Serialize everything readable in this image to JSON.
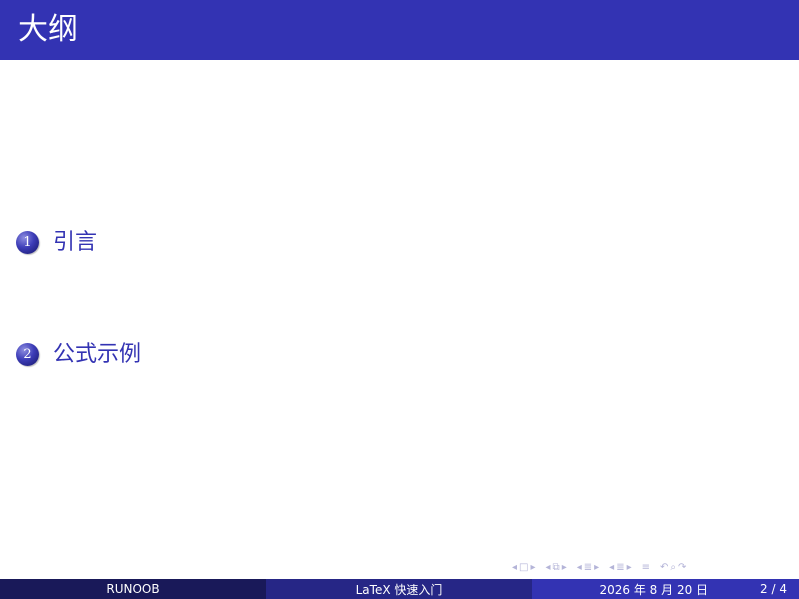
{
  "frame": {
    "title": "大纲"
  },
  "toc": {
    "items": [
      {
        "number": "1",
        "label": "引言"
      },
      {
        "number": "2",
        "label": "公式示例"
      }
    ]
  },
  "nav": {
    "icons": [
      "prev-arrow",
      "frame-icon",
      "next-arrow",
      "subsection-icon",
      "section-icon",
      "align-icon",
      "search-icon"
    ]
  },
  "footer": {
    "author": "RUNOOB",
    "title": "LaTeX 快速入门",
    "date": "2026 年 8 月 20 日",
    "page": "2 / 4"
  },
  "colors": {
    "header_bg": "#3333b3",
    "footer_author_bg": "#191959",
    "footer_title_bg": "#262686",
    "footer_date_bg": "#3333b3",
    "toc_text": "#3333b3"
  }
}
